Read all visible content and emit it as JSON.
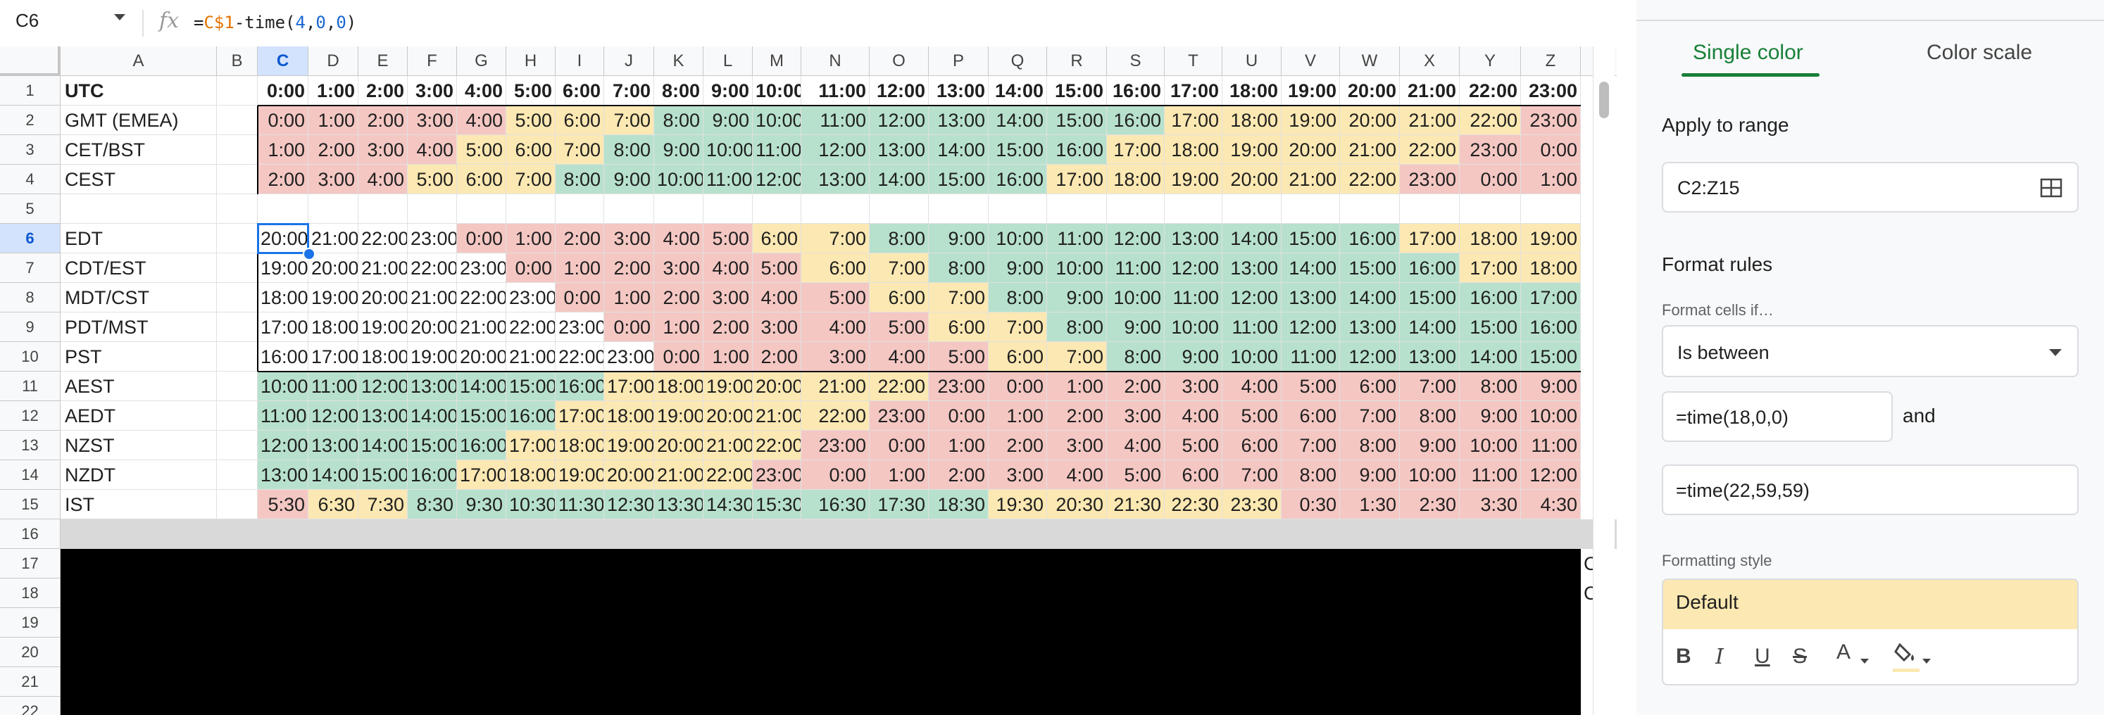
{
  "formula_bar": {
    "name_box": "C6",
    "fx": "fx",
    "formula": "=C$1-time(4,0,0)"
  },
  "colors": {
    "green": "#b7e1cd",
    "yellow": "#fce8b2",
    "red": "#f4c7c3",
    "accent": "#1a73e8",
    "panel_green": "#188038"
  },
  "active_cell": "C6",
  "columns": [
    "A",
    "B",
    "C",
    "D",
    "E",
    "F",
    "G",
    "H",
    "I",
    "J",
    "K",
    "L",
    "M",
    "N",
    "O",
    "P",
    "Q",
    "R",
    "S",
    "T",
    "U",
    "V",
    "W",
    "X",
    "Y",
    "Z"
  ],
  "row_numbers": [
    "1",
    "2",
    "3",
    "4",
    "5",
    "6",
    "7",
    "8",
    "9",
    "10",
    "11",
    "12",
    "13",
    "14",
    "15",
    "16",
    "17",
    "18",
    "19",
    "20",
    "21",
    "22"
  ],
  "table_rows": [
    {
      "row": 1,
      "label": "UTC",
      "bold": true,
      "values": [
        "0:00",
        "1:00",
        "2:00",
        "3:00",
        "4:00",
        "5:00",
        "6:00",
        "7:00",
        "8:00",
        "9:00",
        "10:00",
        "11:00",
        "12:00",
        "13:00",
        "14:00",
        "15:00",
        "16:00",
        "17:00",
        "18:00",
        "19:00",
        "20:00",
        "21:00",
        "22:00",
        "23:00"
      ],
      "colors": "wwwwwwwwwwwwwwwwwwwwwwww"
    },
    {
      "row": 2,
      "label": "GMT (EMEA)",
      "values": [
        "0:00",
        "1:00",
        "2:00",
        "3:00",
        "4:00",
        "5:00",
        "6:00",
        "7:00",
        "8:00",
        "9:00",
        "10:00",
        "11:00",
        "12:00",
        "13:00",
        "14:00",
        "15:00",
        "16:00",
        "17:00",
        "18:00",
        "19:00",
        "20:00",
        "21:00",
        "22:00",
        "23:00"
      ],
      "colors": "rrrrryyygggggggggyyyyyyr"
    },
    {
      "row": 3,
      "label": "CET/BST",
      "values": [
        "1:00",
        "2:00",
        "3:00",
        "4:00",
        "5:00",
        "6:00",
        "7:00",
        "8:00",
        "9:00",
        "10:00",
        "11:00",
        "12:00",
        "13:00",
        "14:00",
        "15:00",
        "16:00",
        "17:00",
        "18:00",
        "19:00",
        "20:00",
        "21:00",
        "22:00",
        "23:00",
        "0:00"
      ],
      "colors": "rrrryyygggggggggyyyyyyrr"
    },
    {
      "row": 4,
      "label": "CEST",
      "values": [
        "2:00",
        "3:00",
        "4:00",
        "5:00",
        "6:00",
        "7:00",
        "8:00",
        "9:00",
        "10:00",
        "11:00",
        "12:00",
        "13:00",
        "14:00",
        "15:00",
        "16:00",
        "17:00",
        "18:00",
        "19:00",
        "20:00",
        "21:00",
        "22:00",
        "23:00",
        "0:00",
        "1:00"
      ],
      "colors": "rrryyygggggggggyyyyyyrrr"
    },
    {
      "row": 5,
      "label": "",
      "values": [
        "",
        "",
        "",
        "",
        "",
        "",
        "",
        "",
        "",
        "",
        "",
        "",
        "",
        "",
        "",
        "",
        "",
        "",
        "",
        "",
        "",
        "",
        "",
        ""
      ],
      "colors": "wwwwwwwwwwwwwwwwwwwwwwww"
    },
    {
      "row": 6,
      "label": "EDT",
      "values": [
        "20:00",
        "21:00",
        "22:00",
        "23:00",
        "0:00",
        "1:00",
        "2:00",
        "3:00",
        "4:00",
        "5:00",
        "6:00",
        "7:00",
        "8:00",
        "9:00",
        "10:00",
        "11:00",
        "12:00",
        "13:00",
        "14:00",
        "15:00",
        "16:00",
        "17:00",
        "18:00",
        "19:00"
      ],
      "colors": "wwwwrrrrrryygggggggggyyy"
    },
    {
      "row": 7,
      "label": "CDT/EST",
      "values": [
        "19:00",
        "20:00",
        "21:00",
        "22:00",
        "23:00",
        "0:00",
        "1:00",
        "2:00",
        "3:00",
        "4:00",
        "5:00",
        "6:00",
        "7:00",
        "8:00",
        "9:00",
        "10:00",
        "11:00",
        "12:00",
        "13:00",
        "14:00",
        "15:00",
        "16:00",
        "17:00",
        "18:00"
      ],
      "colors": "wwwwwrrrrrryygggggggggyy"
    },
    {
      "row": 8,
      "label": "MDT/CST",
      "values": [
        "18:00",
        "19:00",
        "20:00",
        "21:00",
        "22:00",
        "23:00",
        "0:00",
        "1:00",
        "2:00",
        "3:00",
        "4:00",
        "5:00",
        "6:00",
        "7:00",
        "8:00",
        "9:00",
        "10:00",
        "11:00",
        "12:00",
        "13:00",
        "14:00",
        "15:00",
        "16:00",
        "17:00"
      ],
      "colors": "wwwwwwrrrrrryygggggggggg"
    },
    {
      "row": 9,
      "label": "PDT/MST",
      "values": [
        "17:00",
        "18:00",
        "19:00",
        "20:00",
        "21:00",
        "22:00",
        "23:00",
        "0:00",
        "1:00",
        "2:00",
        "3:00",
        "4:00",
        "5:00",
        "6:00",
        "7:00",
        "8:00",
        "9:00",
        "10:00",
        "11:00",
        "12:00",
        "13:00",
        "14:00",
        "15:00",
        "16:00"
      ],
      "colors": "wwwwwwwrrrrrryyggggggggg"
    },
    {
      "row": 10,
      "label": "PST",
      "values": [
        "16:00",
        "17:00",
        "18:00",
        "19:00",
        "20:00",
        "21:00",
        "22:00",
        "23:00",
        "0:00",
        "1:00",
        "2:00",
        "3:00",
        "4:00",
        "5:00",
        "6:00",
        "7:00",
        "8:00",
        "9:00",
        "10:00",
        "11:00",
        "12:00",
        "13:00",
        "14:00",
        "15:00"
      ],
      "colors": "wwwwwwwwrrrrrryygggggggg"
    },
    {
      "row": 11,
      "label": "AEST",
      "values": [
        "10:00",
        "11:00",
        "12:00",
        "13:00",
        "14:00",
        "15:00",
        "16:00",
        "17:00",
        "18:00",
        "19:00",
        "20:00",
        "21:00",
        "22:00",
        "23:00",
        "0:00",
        "1:00",
        "2:00",
        "3:00",
        "4:00",
        "5:00",
        "6:00",
        "7:00",
        "8:00",
        "9:00"
      ],
      "colors": "gggggggyyyyyyrrrrrrrrrrr"
    },
    {
      "row": 12,
      "label": "AEDT",
      "values": [
        "11:00",
        "12:00",
        "13:00",
        "14:00",
        "15:00",
        "16:00",
        "17:00",
        "18:00",
        "19:00",
        "20:00",
        "21:00",
        "22:00",
        "23:00",
        "0:00",
        "1:00",
        "2:00",
        "3:00",
        "4:00",
        "5:00",
        "6:00",
        "7:00",
        "8:00",
        "9:00",
        "10:00"
      ],
      "colors": "ggggggyyyyyyrrrrrrrrrrrr"
    },
    {
      "row": 13,
      "label": "NZST",
      "values": [
        "12:00",
        "13:00",
        "14:00",
        "15:00",
        "16:00",
        "17:00",
        "18:00",
        "19:00",
        "20:00",
        "21:00",
        "22:00",
        "23:00",
        "0:00",
        "1:00",
        "2:00",
        "3:00",
        "4:00",
        "5:00",
        "6:00",
        "7:00",
        "8:00",
        "9:00",
        "10:00",
        "11:00"
      ],
      "colors": "gggggyyyyyyrrrrrrrrrrrrr"
    },
    {
      "row": 14,
      "label": "NZDT",
      "values": [
        "13:00",
        "14:00",
        "15:00",
        "16:00",
        "17:00",
        "18:00",
        "19:00",
        "20:00",
        "21:00",
        "22:00",
        "23:00",
        "0:00",
        "1:00",
        "2:00",
        "3:00",
        "4:00",
        "5:00",
        "6:00",
        "7:00",
        "8:00",
        "9:00",
        "10:00",
        "11:00",
        "12:00"
      ],
      "colors": "ggggyyyyyyrrrrrrrrrrrrrr"
    },
    {
      "row": 15,
      "label": "IST",
      "values": [
        "5:30",
        "6:30",
        "7:30",
        "8:30",
        "9:30",
        "10:30",
        "11:30",
        "12:30",
        "13:30",
        "14:30",
        "15:30",
        "16:30",
        "17:30",
        "18:30",
        "19:30",
        "20:30",
        "21:30",
        "22:30",
        "23:30",
        "0:30",
        "1:30",
        "2:30",
        "3:30",
        "4:30"
      ],
      "colors": "ryygggggggggggyyyyyrrrrr"
    }
  ],
  "overflow_text": {
    "row17": "C",
    "row18": "C"
  },
  "panel": {
    "tab_single": "Single color",
    "tab_scale": "Color scale",
    "apply_title": "Apply to range",
    "range_value": "C2:Z15",
    "format_rules_title": "Format rules",
    "format_cells_if": "Format cells if…",
    "condition": "Is between",
    "value1": "=time(18,0,0)",
    "and_label": "and",
    "value2": "=time(22,59,59)",
    "formatting_style_label": "Formatting style",
    "style_preview": "Default",
    "buttons": {
      "bold": "B",
      "italic": "I",
      "underline": "U",
      "strike": "S",
      "text_color": "A"
    }
  }
}
